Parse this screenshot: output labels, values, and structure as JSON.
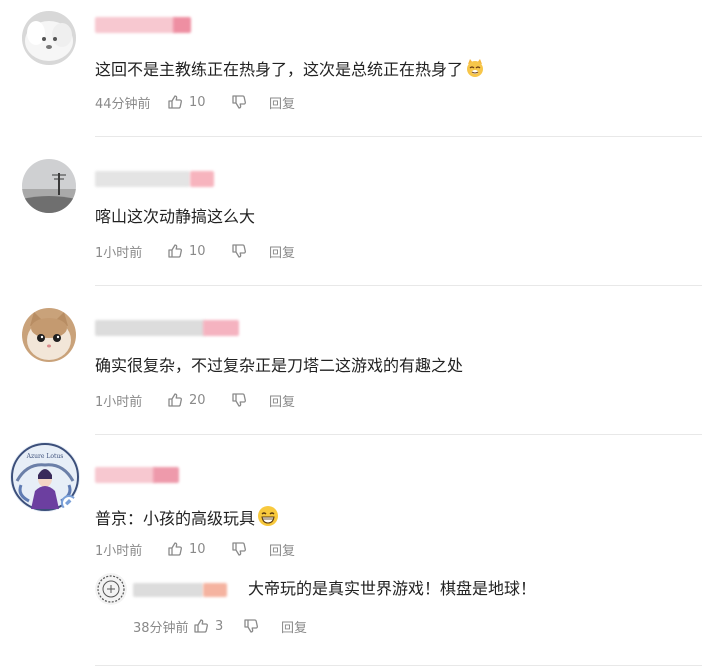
{
  "comments": [
    {
      "text": "这回不是主教练正在热身了，这次是总统正在热身了",
      "emoji": "cat-face-emoji",
      "time": "44分钟前",
      "likes": "10",
      "reply_label": "回复"
    },
    {
      "text": "喀山这次动静搞这么大",
      "time": "1小时前",
      "likes": "10",
      "reply_label": "回复"
    },
    {
      "text": "确实很复杂，不过复杂正是刀塔二这游戏的有趣之处",
      "time": "1小时前",
      "likes": "20",
      "reply_label": "回复"
    },
    {
      "text": "普京：小孩的高级玩具",
      "emoji": "grinning-face-emoji",
      "time": "1小时前",
      "likes": "10",
      "reply_label": "回复",
      "avatar_text": "Azure Lotus"
    }
  ],
  "reply": {
    "text": "大帝玩的是真实世界游戏！棋盘是地球！",
    "time": "38分钟前",
    "likes": "3",
    "reply_label": "回复"
  },
  "colors": {
    "name_blur_pink": "#f6b9c4",
    "name_blur_gray": "#d9d9d9",
    "meta_gray": "#8a8a8a",
    "divider": "#e8e8e8"
  }
}
